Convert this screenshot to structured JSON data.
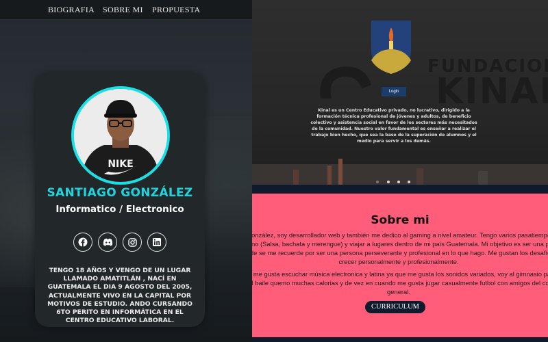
{
  "nav": {
    "items": [
      "BIOGRAFIA",
      "SOBRE MI",
      "PROPUESTA"
    ]
  },
  "profile": {
    "name": "SANTIAGO GONZÁLEZ",
    "role": "Informatico / Electronico",
    "bio": "TENGO 18 AÑOS Y VENGO DE UN LUGAR LLAMADO AMATITLÁN , NACÍ EN GUATEMALA EL DIA 9 AGOSTO DEL 2005, ACTUALMENTE VIVO EN LA CAPITAL POR MOTIVOS DE ESTUDIO. ANDO CURSANDO 6TO PERITO EN INFORMÁTICA EN EL CENTRO EDUCATIVO LABORAL.",
    "shirt_text": "NIKE",
    "socials": [
      "facebook-icon",
      "discord-icon",
      "instagram-icon",
      "linkedin-icon"
    ]
  },
  "hero": {
    "login_label": "Login",
    "description": "Kinal es un Centro Educativo privado, no lucrativo, dirigido a la formación técnica profesional de jóvenes y adultos, de beneficio colectivo y asistencia social en favor de los sectores más necesitados de la comunidad. Nuestro valor fundamental es enseñar a realizar el trabajo bien hecho, que sea la base de la superación de alumnos y el medio para servir a los demás.",
    "background_text": [
      "FUNDACION",
      "KINAL"
    ]
  },
  "about": {
    "title": "Sobre mi",
    "paragraph1": [
      "González, soy desarrollador web y también me dedico al gaming a nivel amateur. Tengo varios pasatiempo",
      "tino (Salsa, bachata y merengue) y viajar a lugares dentro de mi país Guatemala. Mi objetivo es ser una p",
      "nde se me recuerde por ser una persona perseverante y profesional en lo que hago. Me gustan los desafío",
      "crecer personalmente y profesionalmente."
    ],
    "paragraph2": [
      "al me gusta escuchar música electronica y latina ya que me gusta los sonidos variados, voy al gimnasio pa",
      "el baile quemo muchas calorias y de vez en cuando me gusta jugar casualmente futbol con amigos del co",
      "general."
    ],
    "button_label": "CURRICULUM"
  },
  "colors": {
    "accent": "#18e0e6",
    "pink": "#ff5d79",
    "navy": "#0f1a2c",
    "login": "#1b3d6b"
  }
}
